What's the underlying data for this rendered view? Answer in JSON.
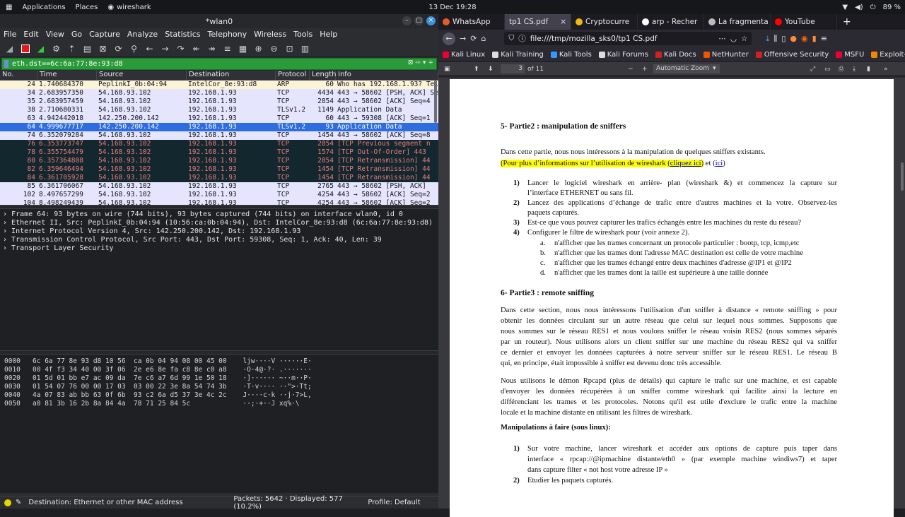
{
  "top_panel": {
    "applications": "Applications",
    "places": "Places",
    "wireshark": "wireshark",
    "clock": "13 Dec 19:28",
    "battery": "89 %"
  },
  "wireshark": {
    "title": "*wlan0",
    "menu": [
      "File",
      "Edit",
      "View",
      "Go",
      "Capture",
      "Analyze",
      "Statistics",
      "Telephony",
      "Wireless",
      "Tools",
      "Help"
    ],
    "filter": "eth.dst==6c:6a:77:8e:93:d8",
    "columns": [
      "No.",
      "Time",
      "Source",
      "Destination",
      "Protocol",
      "Length",
      "Info"
    ],
    "packets": [
      {
        "no": "24",
        "time": "1.740684370",
        "src": "PeplinkI_0b:04:94",
        "dst": "IntelCor_8e:93:d8",
        "proto": "ARP",
        "len": "60",
        "info": "Who has 192.168.1.93? Tell",
        "style": "arp"
      },
      {
        "no": "34",
        "time": "2.683957350",
        "src": "54.168.93.102",
        "dst": "192.168.1.93",
        "proto": "TCP",
        "len": "4434",
        "info": "443 → 58602 [PSH, ACK] Se",
        "style": "tcp"
      },
      {
        "no": "35",
        "time": "2.683957459",
        "src": "54.168.93.102",
        "dst": "192.168.1.93",
        "proto": "TCP",
        "len": "2854",
        "info": "443 → 58602 [ACK] Seq=4",
        "style": "tcp"
      },
      {
        "no": "38",
        "time": "2.710680331",
        "src": "54.168.93.102",
        "dst": "192.168.1.93",
        "proto": "TLSv1.2",
        "len": "1149",
        "info": "Application Data",
        "style": "tcp"
      },
      {
        "no": "63",
        "time": "4.942442018",
        "src": "142.250.200.142",
        "dst": "192.168.1.93",
        "proto": "TCP",
        "len": "60",
        "info": "443 → 59308 [ACK] Seq=1",
        "style": "tcp"
      },
      {
        "no": "64",
        "time": "4.999677717",
        "src": "142.250.200.142",
        "dst": "192.168.1.93",
        "proto": "TLSv1.2",
        "len": "93",
        "info": "Application Data",
        "style": "sel"
      },
      {
        "no": "74",
        "time": "6.352079284",
        "src": "54.168.93.102",
        "dst": "192.168.1.93",
        "proto": "TCP",
        "len": "1454",
        "info": "443 → 58602 [ACK] Seq=8",
        "style": "tcp"
      },
      {
        "no": "76",
        "time": "6.353773747",
        "src": "54.168.93.102",
        "dst": "192.168.1.93",
        "proto": "TCP",
        "len": "2854",
        "info": "[TCP Previous segment n",
        "style": "bad"
      },
      {
        "no": "78",
        "time": "6.355754479",
        "src": "54.168.93.102",
        "dst": "192.168.1.93",
        "proto": "TCP",
        "len": "1574",
        "info": "[TCP Out-Of-Order] 443",
        "style": "bad"
      },
      {
        "no": "80",
        "time": "6.357364808",
        "src": "54.168.93.102",
        "dst": "192.168.1.93",
        "proto": "TCP",
        "len": "2854",
        "info": "[TCP Retransmission] 44",
        "style": "bad"
      },
      {
        "no": "82",
        "time": "6.359646494",
        "src": "54.168.93.102",
        "dst": "192.168.1.93",
        "proto": "TCP",
        "len": "1454",
        "info": "[TCP Retransmission] 44",
        "style": "bad"
      },
      {
        "no": "84",
        "time": "6.361705928",
        "src": "54.168.93.102",
        "dst": "192.168.1.93",
        "proto": "TCP",
        "len": "1454",
        "info": "[TCP Retransmission] 44",
        "style": "bad"
      },
      {
        "no": "85",
        "time": "6.361706067",
        "src": "54.168.93.102",
        "dst": "192.168.1.93",
        "proto": "TCP",
        "len": "2765",
        "info": "443 → 58602 [PSH, ACK]",
        "style": "tcp"
      },
      {
        "no": "102",
        "time": "8.497657299",
        "src": "54.168.93.102",
        "dst": "192.168.1.93",
        "proto": "TCP",
        "len": "4254",
        "info": "443 → 58602 [ACK] Seq=2",
        "style": "tcp"
      },
      {
        "no": "104",
        "time": "8.498249439",
        "src": "54.168.93.102",
        "dst": "192.168.1.93",
        "proto": "TCP",
        "len": "4254",
        "info": "443 → 58602 [ACK] Seq=2",
        "style": "tcp"
      }
    ],
    "details": [
      "Frame 64: 93 bytes on wire (744 bits), 93 bytes captured (744 bits) on interface wlan0, id 0",
      "Ethernet II, Src: PeplinkI_0b:04:94 (10:56:ca:0b:04:94), Dst: IntelCor_8e:93:d8 (6c:6a:77:8e:93:d8)",
      "Internet Protocol Version 4, Src: 142.250.200.142, Dst: 192.168.1.93",
      "Transmission Control Protocol, Src Port: 443, Dst Port: 59308, Seq: 1, Ack: 40, Len: 39",
      "Transport Layer Security"
    ],
    "bytes": [
      "0000   6c 6a 77 8e 93 d8 10 56  ca 0b 04 94 08 00 45 00    ljw····V ······E·",
      "0010   00 4f f3 34 40 00 3f 06  2e e6 8e fa c8 8e c0 a8    ·O·4@·?· .·······",
      "0020   01 5d 01 bb e7 ac 09 da  7e c6 a7 6d 99 1e 50 18    ·]······ ~··m··P·",
      "0030   01 54 07 76 00 00 17 03  03 00 22 3e 8a 54 74 3b    ·T·v···· ··\">·Tt;",
      "0040   4a 07 83 ab bb 63 0f 6b  93 c2 6a d5 37 3e 4c 2c    J····c·k ··j·7>L,",
      "0050   a0 81 3b 16 2b 8a 84 4a  78 71 25 84 5c             ··;·+··J xq%·\\"
    ],
    "status": {
      "field": "Destination: Ethernet or other MAC address",
      "packets": "Packets: 5642 · Displayed: 577 (10.2%)",
      "profile": "Profile: Default"
    }
  },
  "firefox": {
    "tabs": [
      {
        "label": "WhatsApp",
        "color": "#e55b2b"
      },
      {
        "label": "tp1 CS.pdf",
        "color": ""
      },
      {
        "label": "Cryptocurre",
        "color": "#f0b90b"
      },
      {
        "label": "arp - Recher",
        "color": "#ffffff"
      },
      {
        "label": "La fragmenta",
        "color": "#bbbbbb"
      },
      {
        "label": "YouTube",
        "color": "#ff0000"
      }
    ],
    "url": "file:///tmp/mozilla_sks0/tp1 CS.pdf",
    "bookmarks": [
      "Kali Linux",
      "Kali Training",
      "Kali Tools",
      "Kali Forums",
      "Kali Docs",
      "NetHunter",
      "Offensive Security",
      "MSFU",
      "Exploit-DB"
    ],
    "pdf_toolbar": {
      "page": "3",
      "of": "of 11",
      "zoom": "Automatic Zoom"
    }
  },
  "pdf": {
    "h5": "5- Partie2 : manipulation de sniffers",
    "p5": "Dans cette partie, nous nous intéressons à la manipulation de quelques sniffers existants.",
    "p5_hl": "(Pour plus d’informations sur l’utilisation de wireshark (",
    "p5_link1": "cliquez ici",
    "p5_mid": ") et (",
    "p5_link2": "ici",
    "p5_end": ")",
    "list5": [
      {
        "n": "1)",
        "lines": [
          "Lancer le logiciel wireshark en arrière- plan (wireshark &) et commencez la capture sur",
          "l’interface ETHERNET ou sans fil."
        ]
      },
      {
        "n": "2)",
        "lines": [
          "Lancez des applications d’échange de trafic entre d'autres machines et la votre. Observez-les",
          "paquets capturés."
        ]
      },
      {
        "n": "3)",
        "lines": [
          "Est-ce que vous pouvez capturer les trafics échangés entre les machines du reste du réseau?"
        ]
      },
      {
        "n": "4)",
        "lines": [
          "Configurer le filtre de wireshark pour (voir annexe 2)."
        ]
      }
    ],
    "sub5": [
      {
        "n": "a.",
        "t": "n'afficher que les trames concernant un protocole particulier : bootp, tcp, icmp,etc"
      },
      {
        "n": "b.",
        "t": "n'afficher que les trames dont l'adresse MAC destination est celle de votre machine"
      },
      {
        "n": "c.",
        "t": "n'afficher que les trames échangé entre deux machines d'adresse @IP1 et @IP2"
      },
      {
        "n": "d.",
        "t": "n'afficher que les trames dont la taille est supérieure à une taille donnée"
      }
    ],
    "h6": "6- Partie3 : remote sniffing",
    "p6": [
      "Dans cette section, nous nous intéressons l'utilisation d'un sniffer à distance « remote sniffing » pour",
      "obtenir les données circulant sur un autre réseau que celui sur lequel nous sommes. Supposons que",
      "nous sommes sur le réseau RES1 et nous voulons sniffer le réseau voisin RES2 (nous sommes séparés",
      "par un routeur). Nous utilisons alors un  client sniffer sur une machine du réseau RES2 qui va sniffer",
      "ce dernier et envoyer les données capturées à notre serveur sniffer sur le réseau RES1. Le réseau B",
      "qui, en principe, était impossible à sniffer est devenu donc très accessible."
    ],
    "p7": [
      "Nous utilisons le démon Rpcapd (plus de détails) qui capture le trafic sur une machine, et est capable",
      "d'envoyer les données récupérées à un sniffer comme wireshark qui facilite ainsi la lecture en",
      "différenciant les trames et les protocoles. Notons qu'il est utile d'exclure le trafic entre la machine",
      "locale et la machine distante en utilisant les filtres de wireshark."
    ],
    "h7": "Manipulations à faire (sous linux):",
    "list7": [
      {
        "n": "1)",
        "lines": [
          "Sur votre machine, lancer wireshark et accéder aux options de capture puis taper  dans",
          "interface « rpcap://@ipmachine distante/eth0 » (par exemple machine windiws7) et taper",
          "dans capture filter « not host votre adresse IP »"
        ]
      },
      {
        "n": "2)",
        "lines": [
          "Etudier les paquets capturés."
        ]
      }
    ]
  }
}
